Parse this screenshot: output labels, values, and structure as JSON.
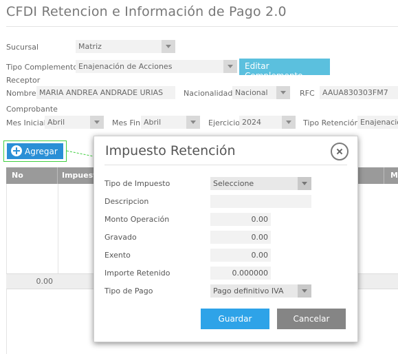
{
  "page": {
    "title": "CFDI Retencion e Información de Pago 2.0"
  },
  "form": {
    "sucursal_label": "Sucursal",
    "sucursal_value": "Matriz",
    "tipo_complemento_label": "Tipo Complemento",
    "tipo_complemento_value": "Enajenación de Acciones",
    "editar_label": "Editar Complemento",
    "receptor_label": "Receptor",
    "nombre_label": "Nombre",
    "nombre_value": "MARIA ANDREA ANDRADE URIAS",
    "nacionalidad_label": "Nacionalidad",
    "nacionalidad_value": "Nacional",
    "rfc_label": "RFC",
    "rfc_value": "AAUA830303FM7",
    "comprobante_label": "Comprobante",
    "mes_inicial_label": "Mes Inicial",
    "mes_inicial_value": "Abril",
    "mes_fin_label": "Mes Fin",
    "mes_fin_value": "Abril",
    "ejercicio_label": "Ejercicio",
    "ejercicio_value": "2024",
    "tipo_retencion_label": "Tipo Retención",
    "tipo_retencion_value": "Enajenación"
  },
  "toolbar": {
    "agregar_label": "Agregar"
  },
  "table": {
    "col_no": "No",
    "col_impuesto": "Impuesto",
    "col_m": "M",
    "total": "0.00"
  },
  "modal": {
    "title": "Impuesto Retención",
    "tipo_impuesto_label": "Tipo de Impuesto",
    "tipo_impuesto_value": "Seleccione",
    "descripcion_label": "Descripcion",
    "descripcion_value": "",
    "monto_operacion_label": "Monto Operación",
    "monto_operacion_value": "0.00",
    "gravado_label": "Gravado",
    "gravado_value": "0.00",
    "exento_label": "Exento",
    "exento_value": "0.00",
    "importe_retenido_label": "Importe Retenido",
    "importe_retenido_value": "0.000000",
    "tipo_pago_label": "Tipo de Pago",
    "tipo_pago_value": "Pago definitivo IVA",
    "guardar_label": "Guardar",
    "cancelar_label": "Cancelar"
  },
  "colors": {
    "agregar": "#2a8fd6",
    "highlight": "#3fcf3f",
    "editar": "#5bc0de",
    "guardar": "#2ea3e8",
    "cancelar": "#858585"
  },
  "icons": {
    "add": "plus-circle-icon",
    "close": "close-circle-icon",
    "dropdown": "chevron-down-icon"
  }
}
